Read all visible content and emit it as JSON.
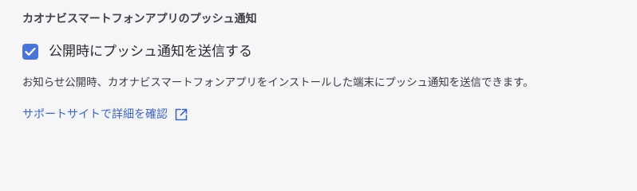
{
  "section": {
    "title": "カオナビスマートフォンアプリのプッシュ通知"
  },
  "push_setting": {
    "checked": true,
    "label": "公開時にプッシュ通知を送信する"
  },
  "description": "お知らせ公開時、カオナビスマートフォンアプリをインストールした端末にプッシュ通知を送信できます。",
  "support_link": {
    "label": "サポートサイトで詳細を確認",
    "icon": "external-link-icon"
  },
  "colors": {
    "accent": "#4a74d6",
    "link": "#3b64c4",
    "background": "#f6f6f8"
  }
}
